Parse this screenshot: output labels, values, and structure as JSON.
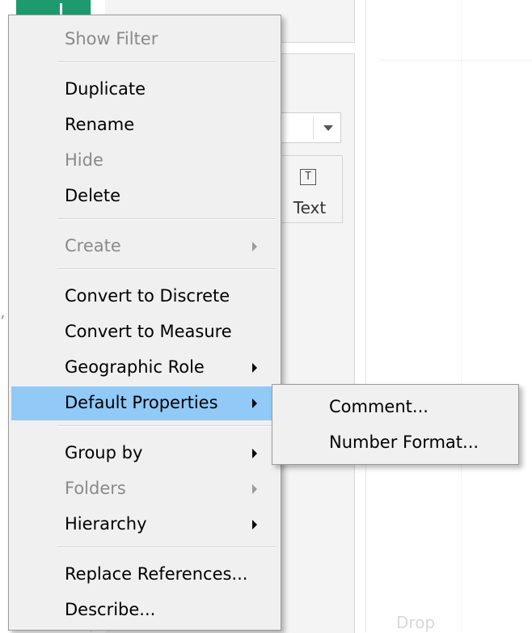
{
  "background": {
    "marks_card_label": "Text",
    "text_icon_glyph": "T",
    "drop_hint": "Drop",
    "left_glyph": "’"
  },
  "context_menu": {
    "items": [
      {
        "label": "Show Filter",
        "enabled": false,
        "submenu": false
      },
      {
        "label": "Duplicate",
        "enabled": true,
        "submenu": false
      },
      {
        "label": "Rename",
        "enabled": true,
        "submenu": false
      },
      {
        "label": "Hide",
        "enabled": false,
        "submenu": false
      },
      {
        "label": "Delete",
        "enabled": true,
        "submenu": false
      },
      {
        "label": "Create",
        "enabled": false,
        "submenu": true
      },
      {
        "label": "Convert to Discrete",
        "enabled": true,
        "submenu": false
      },
      {
        "label": "Convert to Measure",
        "enabled": true,
        "submenu": false
      },
      {
        "label": "Geographic Role",
        "enabled": true,
        "submenu": true
      },
      {
        "label": "Default Properties",
        "enabled": true,
        "submenu": true,
        "highlighted": true
      },
      {
        "label": "Group by",
        "enabled": true,
        "submenu": true
      },
      {
        "label": "Folders",
        "enabled": false,
        "submenu": true
      },
      {
        "label": "Hierarchy",
        "enabled": true,
        "submenu": true
      },
      {
        "label": "Replace References...",
        "enabled": true,
        "submenu": false
      },
      {
        "label": "Describe...",
        "enabled": true,
        "submenu": false
      }
    ]
  },
  "submenu": {
    "items": [
      {
        "label": "Comment..."
      },
      {
        "label": "Number Format..."
      }
    ]
  },
  "colors": {
    "highlight": "#91c9f7",
    "disabled_text": "#8a8a8a",
    "menu_background": "#f0f0f0",
    "accent_green": "#1e9b6e"
  }
}
